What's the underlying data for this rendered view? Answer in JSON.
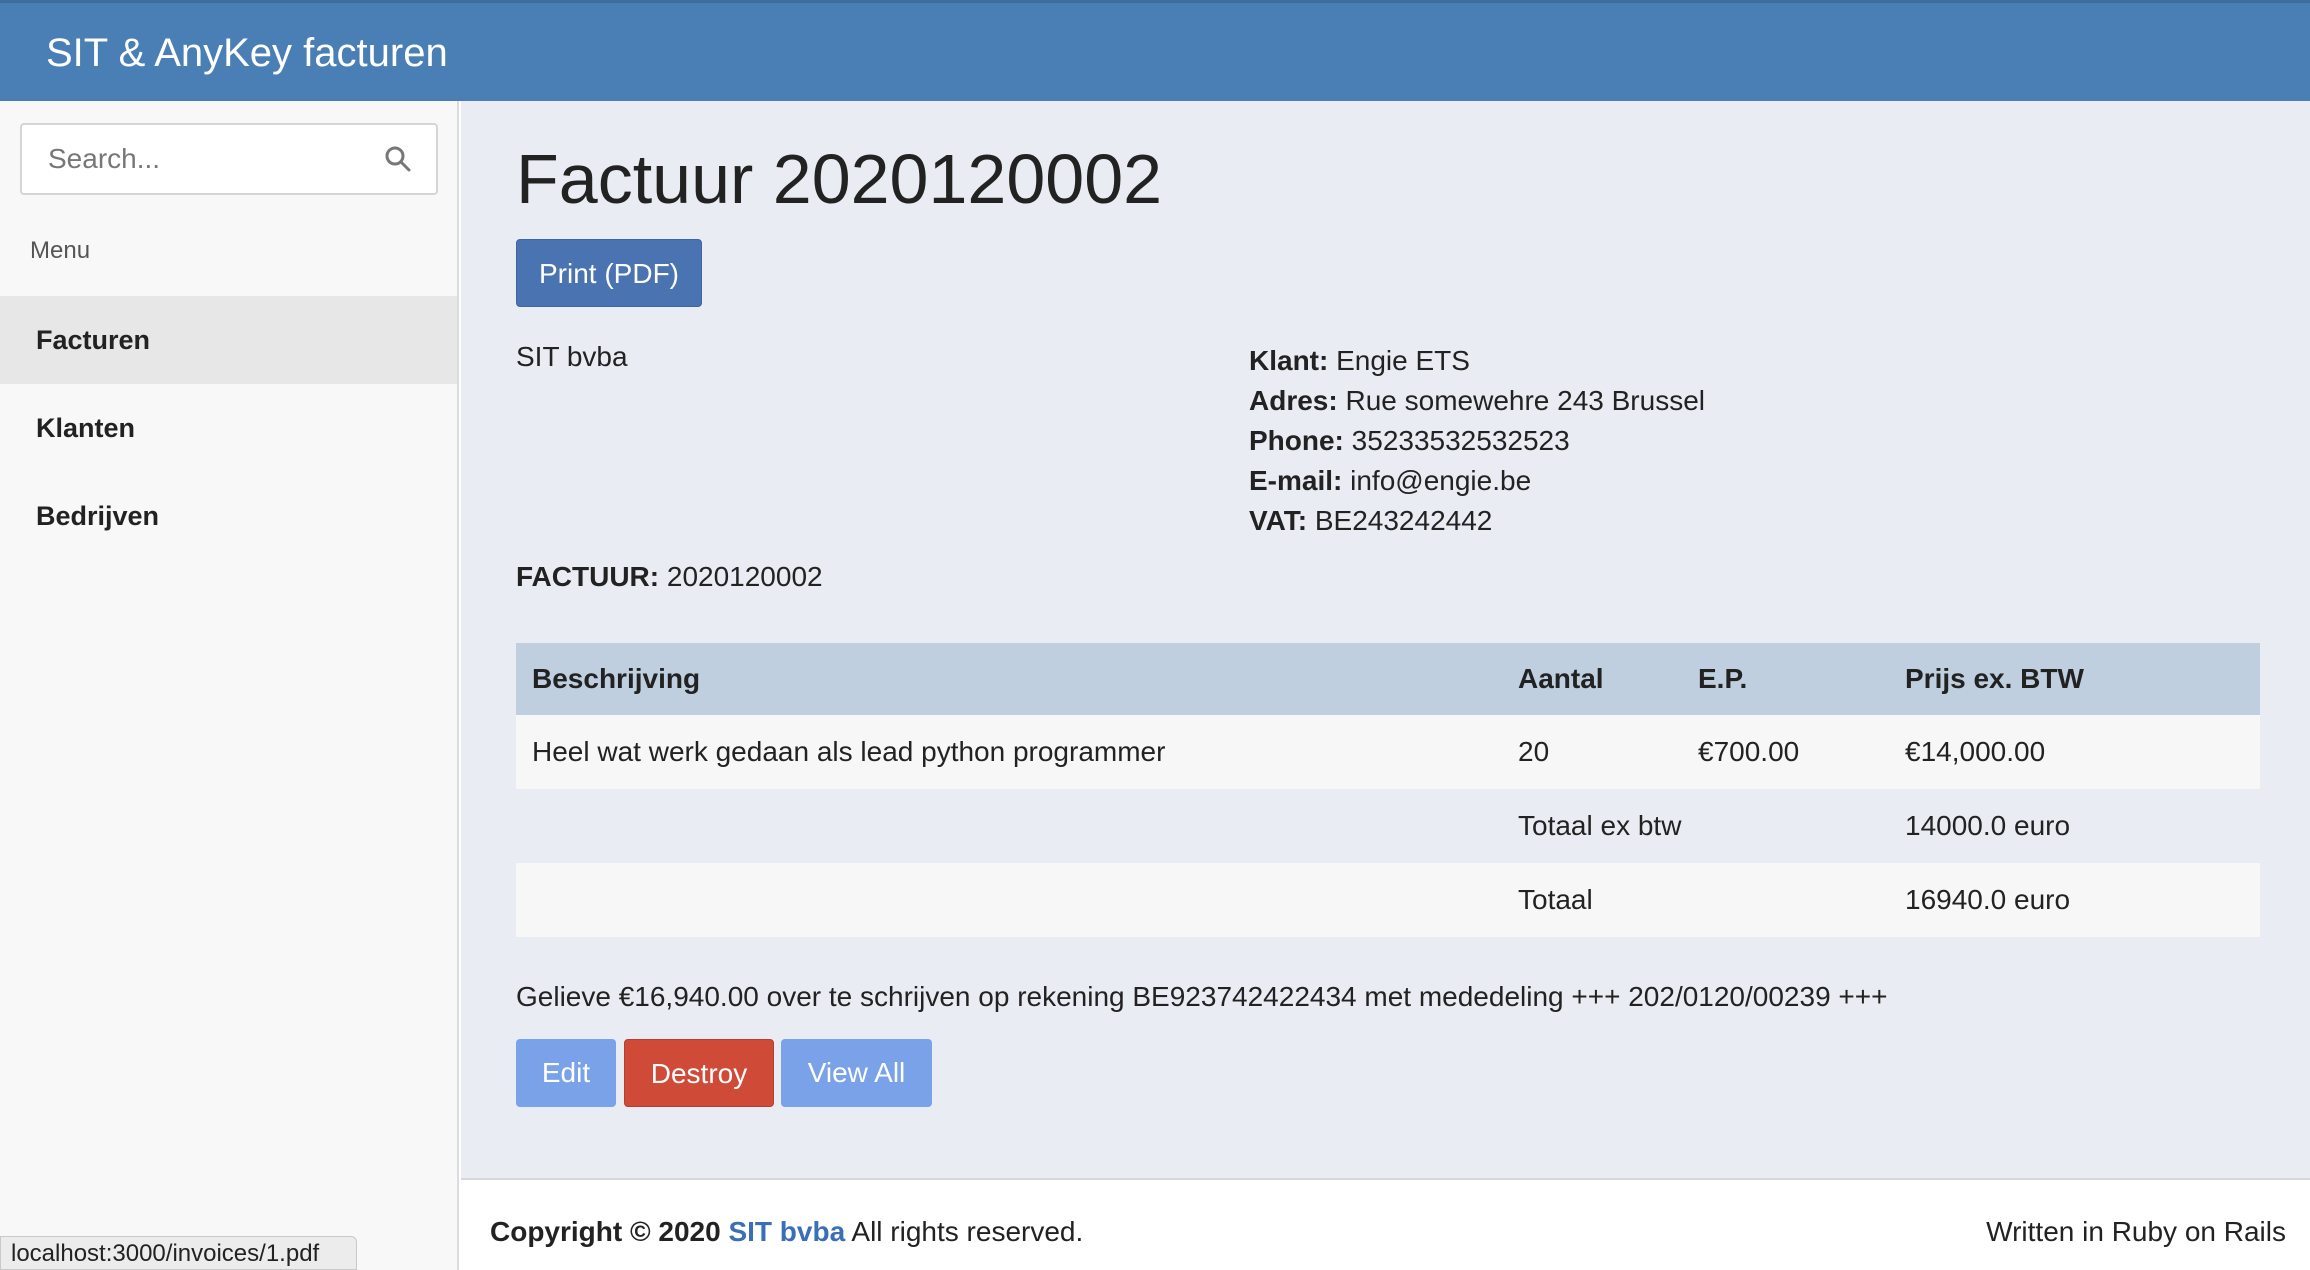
{
  "app": {
    "title": "SIT & AnyKey facturen"
  },
  "sidebar": {
    "search": {
      "placeholder": "Search...",
      "value": "",
      "icon": "search-icon"
    },
    "menu_label": "Menu",
    "items": [
      {
        "label": "Facturen",
        "active": true
      },
      {
        "label": "Klanten",
        "active": false
      },
      {
        "label": "Bedrijven",
        "active": false
      }
    ]
  },
  "main": {
    "title": "Factuur 2020120002",
    "print_button": "Print (PDF)",
    "company": "SIT bvba",
    "client": {
      "klant_label": "Klant:",
      "klant": "Engie ETS",
      "adres_label": "Adres:",
      "adres": "Rue somewehre 243 Brussel",
      "phone_label": "Phone:",
      "phone": "35233532532523",
      "email_label": "E-mail:",
      "email": "info@engie.be",
      "vat_label": "VAT:",
      "vat": "BE243242442"
    },
    "invoice_label": "FACTUUR:",
    "invoice_number": "2020120002",
    "table": {
      "headers": [
        "Beschrijving",
        "Aantal",
        "E.P.",
        "Prijs ex. BTW"
      ],
      "rows": [
        [
          "Heel wat werk gedaan als lead python programmer",
          "20",
          "€700.00",
          "€14,000.00"
        ]
      ],
      "totals": [
        {
          "label": "Totaal ex btw",
          "value": "14000.0 euro"
        },
        {
          "label": "Totaal",
          "value": "16940.0 euro"
        }
      ]
    },
    "payment_text": "Gelieve €16,940.00 over te schrijven op rekening BE923742422434 met mededeling +++ 202/0120/00239 +++",
    "actions": {
      "edit": "Edit",
      "destroy": "Destroy",
      "view_all": "View All"
    }
  },
  "footer": {
    "copyright_prefix": "Copyright © 2020",
    "company_link": "SIT bvba",
    "rights": "All rights reserved.",
    "written": "Written in Ruby on Rails"
  },
  "statusbar": {
    "url": "localhost:3000/invoices/1.pdf"
  },
  "colors": {
    "header": "#4a7fb5",
    "primary": "#4a73b1",
    "danger": "#cf4a37",
    "light_button": "#79a2e8"
  }
}
